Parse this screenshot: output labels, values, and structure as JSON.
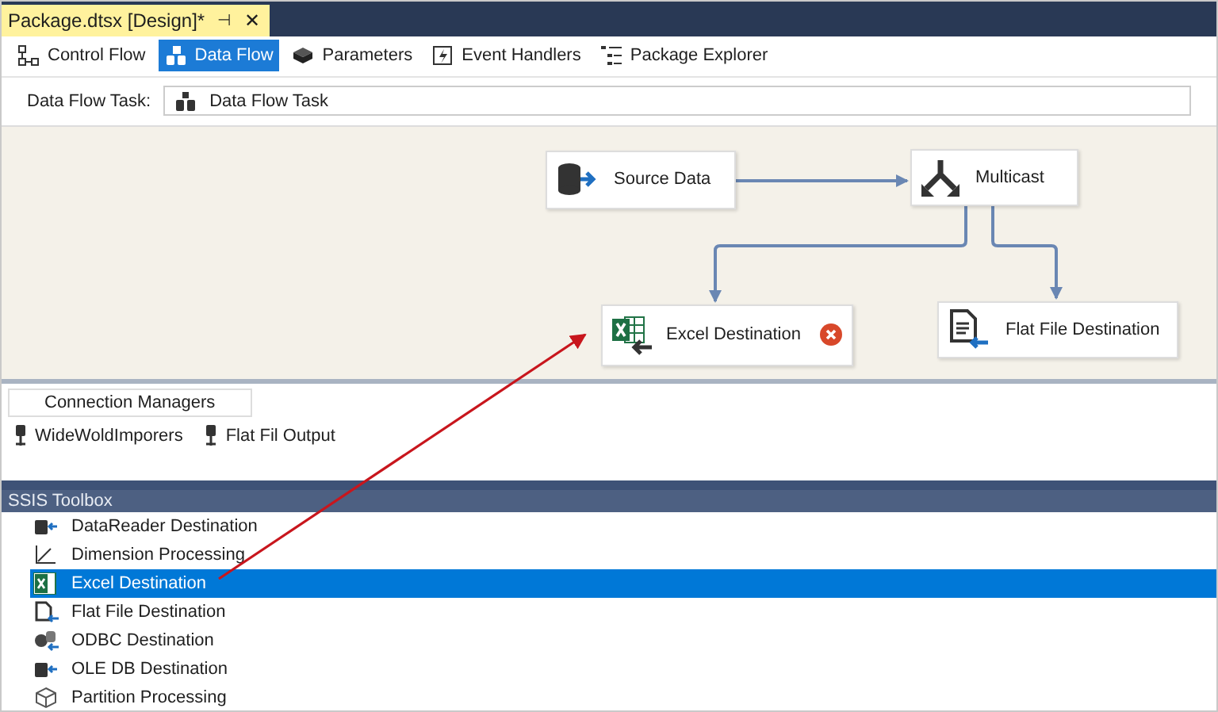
{
  "document_tab": {
    "title": "Package.dtsx [Design]*",
    "pin": "⊣",
    "close": "✕"
  },
  "designer_tabs": [
    {
      "label": "Control Flow",
      "kind": "control",
      "selected": false
    },
    {
      "label": "Data Flow",
      "kind": "dataflow",
      "selected": true
    },
    {
      "label": "Parameters",
      "kind": "parameters",
      "selected": false
    },
    {
      "label": "Event Handlers",
      "kind": "events",
      "selected": false
    },
    {
      "label": "Package Explorer",
      "kind": "explorer",
      "selected": false
    }
  ],
  "task_selector": {
    "label": "Data Flow Task:",
    "value": "Data Flow Task"
  },
  "canvas": {
    "nodes": [
      {
        "label": "Source Data",
        "kind": "source",
        "error": false
      },
      {
        "label": "Multicast",
        "kind": "multicast",
        "error": false
      },
      {
        "label": "Excel Destination",
        "kind": "excel",
        "error": true
      },
      {
        "label": "Flat File Destination",
        "kind": "flatfile",
        "error": false
      }
    ]
  },
  "connection_managers": {
    "tab": "Connection Managers",
    "items": [
      "WideWoldImporers",
      "Flat Fil Output"
    ]
  },
  "toolbox": {
    "title": "SSIS Toolbox",
    "items": [
      {
        "label": "DataReader Destination",
        "kind": "dest",
        "selected": false
      },
      {
        "label": "Dimension Processing",
        "kind": "dimension",
        "selected": false
      },
      {
        "label": "Excel Destination",
        "kind": "excel",
        "selected": true
      },
      {
        "label": "Flat File Destination",
        "kind": "flatfile",
        "selected": false
      },
      {
        "label": "ODBC Destination",
        "kind": "odbc",
        "selected": false
      },
      {
        "label": "OLE DB Destination",
        "kind": "dest",
        "selected": false
      },
      {
        "label": "Partition Processing",
        "kind": "partition",
        "selected": false
      }
    ]
  }
}
